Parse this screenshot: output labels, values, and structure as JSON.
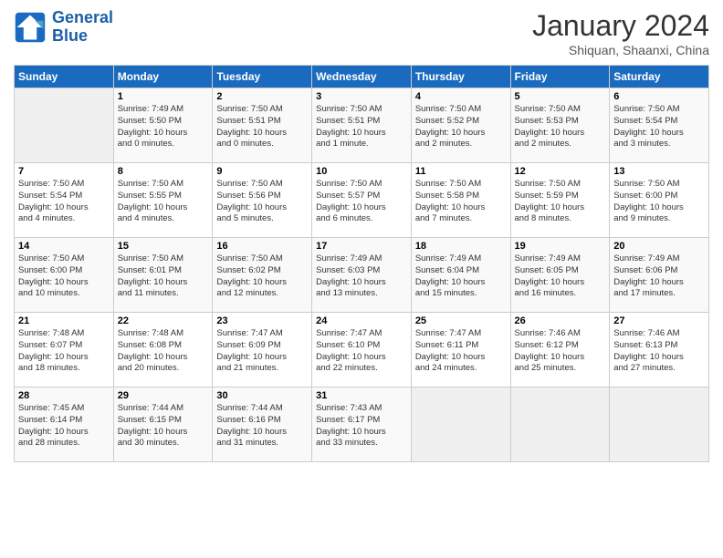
{
  "header": {
    "logo_line1": "General",
    "logo_line2": "Blue",
    "title": "January 2024",
    "subtitle": "Shiquan, Shaanxi, China"
  },
  "days_of_week": [
    "Sunday",
    "Monday",
    "Tuesday",
    "Wednesday",
    "Thursday",
    "Friday",
    "Saturday"
  ],
  "weeks": [
    [
      {
        "day": "",
        "info": ""
      },
      {
        "day": "1",
        "info": "Sunrise: 7:49 AM\nSunset: 5:50 PM\nDaylight: 10 hours\nand 0 minutes."
      },
      {
        "day": "2",
        "info": "Sunrise: 7:50 AM\nSunset: 5:51 PM\nDaylight: 10 hours\nand 0 minutes."
      },
      {
        "day": "3",
        "info": "Sunrise: 7:50 AM\nSunset: 5:51 PM\nDaylight: 10 hours\nand 1 minute."
      },
      {
        "day": "4",
        "info": "Sunrise: 7:50 AM\nSunset: 5:52 PM\nDaylight: 10 hours\nand 2 minutes."
      },
      {
        "day": "5",
        "info": "Sunrise: 7:50 AM\nSunset: 5:53 PM\nDaylight: 10 hours\nand 2 minutes."
      },
      {
        "day": "6",
        "info": "Sunrise: 7:50 AM\nSunset: 5:54 PM\nDaylight: 10 hours\nand 3 minutes."
      }
    ],
    [
      {
        "day": "7",
        "info": "Sunrise: 7:50 AM\nSunset: 5:54 PM\nDaylight: 10 hours\nand 4 minutes."
      },
      {
        "day": "8",
        "info": "Sunrise: 7:50 AM\nSunset: 5:55 PM\nDaylight: 10 hours\nand 4 minutes."
      },
      {
        "day": "9",
        "info": "Sunrise: 7:50 AM\nSunset: 5:56 PM\nDaylight: 10 hours\nand 5 minutes."
      },
      {
        "day": "10",
        "info": "Sunrise: 7:50 AM\nSunset: 5:57 PM\nDaylight: 10 hours\nand 6 minutes."
      },
      {
        "day": "11",
        "info": "Sunrise: 7:50 AM\nSunset: 5:58 PM\nDaylight: 10 hours\nand 7 minutes."
      },
      {
        "day": "12",
        "info": "Sunrise: 7:50 AM\nSunset: 5:59 PM\nDaylight: 10 hours\nand 8 minutes."
      },
      {
        "day": "13",
        "info": "Sunrise: 7:50 AM\nSunset: 6:00 PM\nDaylight: 10 hours\nand 9 minutes."
      }
    ],
    [
      {
        "day": "14",
        "info": "Sunrise: 7:50 AM\nSunset: 6:00 PM\nDaylight: 10 hours\nand 10 minutes."
      },
      {
        "day": "15",
        "info": "Sunrise: 7:50 AM\nSunset: 6:01 PM\nDaylight: 10 hours\nand 11 minutes."
      },
      {
        "day": "16",
        "info": "Sunrise: 7:50 AM\nSunset: 6:02 PM\nDaylight: 10 hours\nand 12 minutes."
      },
      {
        "day": "17",
        "info": "Sunrise: 7:49 AM\nSunset: 6:03 PM\nDaylight: 10 hours\nand 13 minutes."
      },
      {
        "day": "18",
        "info": "Sunrise: 7:49 AM\nSunset: 6:04 PM\nDaylight: 10 hours\nand 15 minutes."
      },
      {
        "day": "19",
        "info": "Sunrise: 7:49 AM\nSunset: 6:05 PM\nDaylight: 10 hours\nand 16 minutes."
      },
      {
        "day": "20",
        "info": "Sunrise: 7:49 AM\nSunset: 6:06 PM\nDaylight: 10 hours\nand 17 minutes."
      }
    ],
    [
      {
        "day": "21",
        "info": "Sunrise: 7:48 AM\nSunset: 6:07 PM\nDaylight: 10 hours\nand 18 minutes."
      },
      {
        "day": "22",
        "info": "Sunrise: 7:48 AM\nSunset: 6:08 PM\nDaylight: 10 hours\nand 20 minutes."
      },
      {
        "day": "23",
        "info": "Sunrise: 7:47 AM\nSunset: 6:09 PM\nDaylight: 10 hours\nand 21 minutes."
      },
      {
        "day": "24",
        "info": "Sunrise: 7:47 AM\nSunset: 6:10 PM\nDaylight: 10 hours\nand 22 minutes."
      },
      {
        "day": "25",
        "info": "Sunrise: 7:47 AM\nSunset: 6:11 PM\nDaylight: 10 hours\nand 24 minutes."
      },
      {
        "day": "26",
        "info": "Sunrise: 7:46 AM\nSunset: 6:12 PM\nDaylight: 10 hours\nand 25 minutes."
      },
      {
        "day": "27",
        "info": "Sunrise: 7:46 AM\nSunset: 6:13 PM\nDaylight: 10 hours\nand 27 minutes."
      }
    ],
    [
      {
        "day": "28",
        "info": "Sunrise: 7:45 AM\nSunset: 6:14 PM\nDaylight: 10 hours\nand 28 minutes."
      },
      {
        "day": "29",
        "info": "Sunrise: 7:44 AM\nSunset: 6:15 PM\nDaylight: 10 hours\nand 30 minutes."
      },
      {
        "day": "30",
        "info": "Sunrise: 7:44 AM\nSunset: 6:16 PM\nDaylight: 10 hours\nand 31 minutes."
      },
      {
        "day": "31",
        "info": "Sunrise: 7:43 AM\nSunset: 6:17 PM\nDaylight: 10 hours\nand 33 minutes."
      },
      {
        "day": "",
        "info": ""
      },
      {
        "day": "",
        "info": ""
      },
      {
        "day": "",
        "info": ""
      }
    ]
  ]
}
